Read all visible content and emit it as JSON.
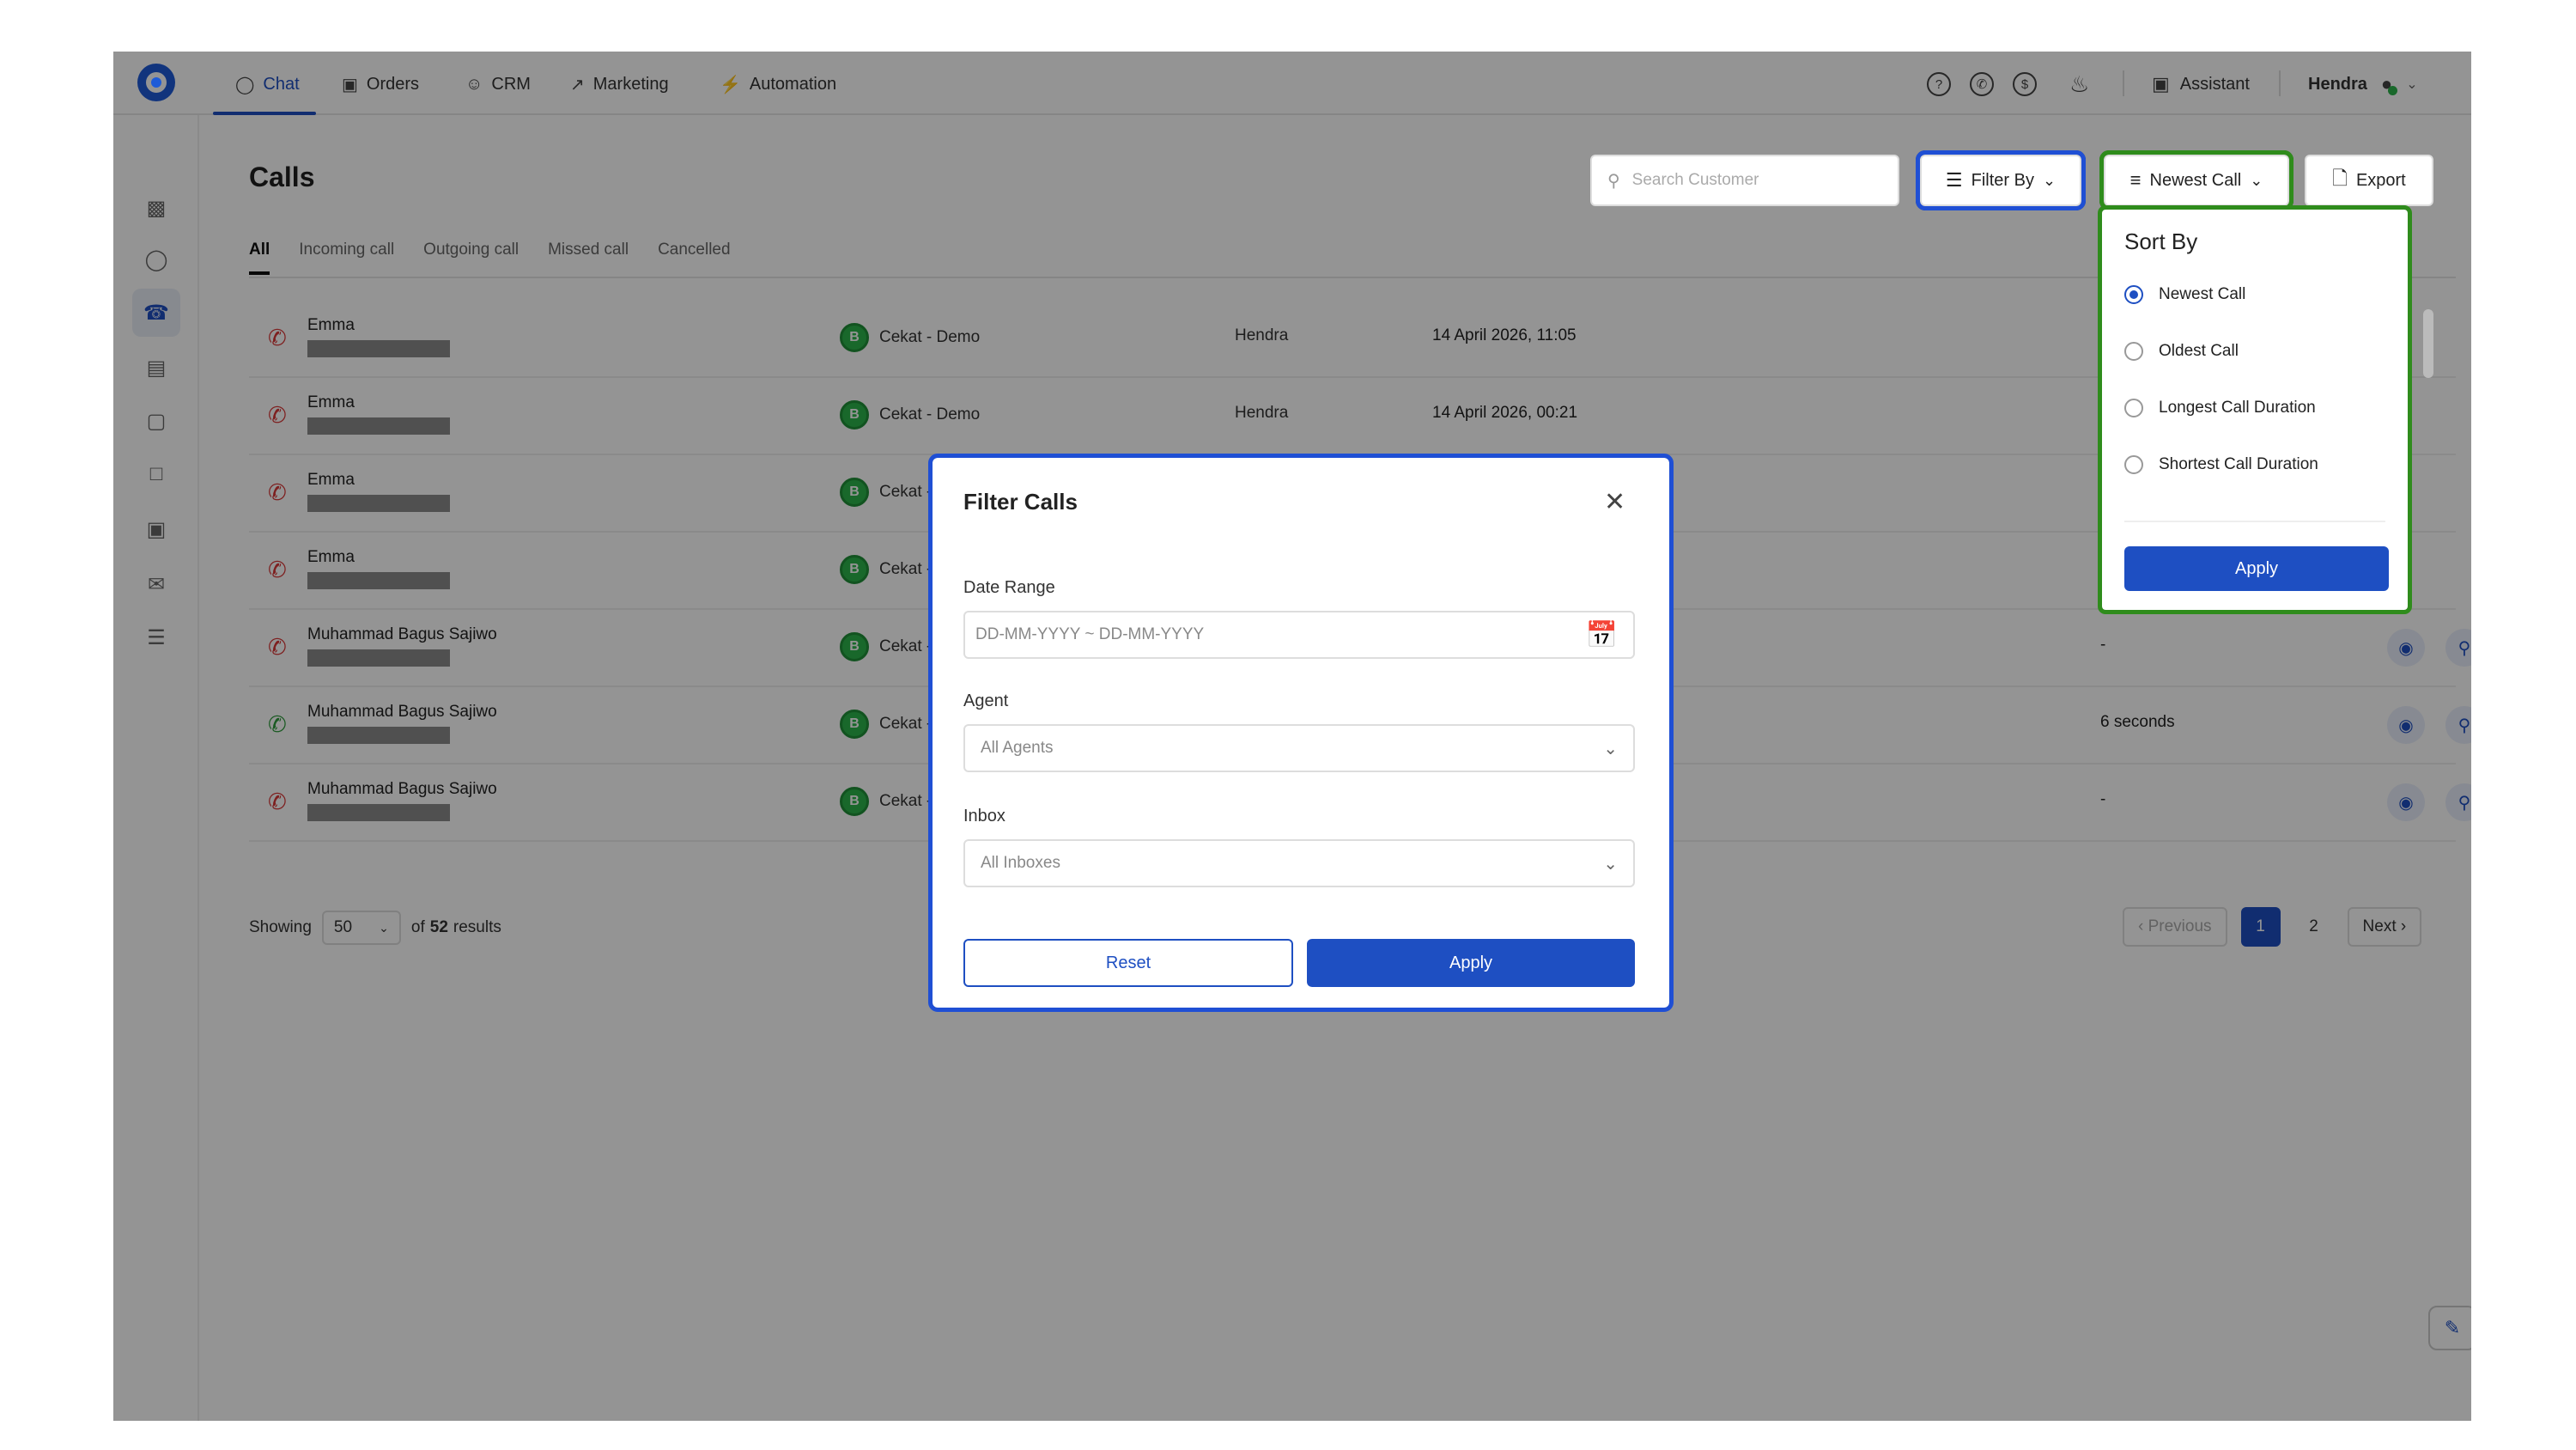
{
  "nav": {
    "tabs": [
      {
        "label": "Chat",
        "icon": "chat-bubble-icon"
      },
      {
        "label": "Orders",
        "icon": "box-icon"
      },
      {
        "label": "CRM",
        "icon": "users-icon"
      },
      {
        "label": "Marketing",
        "icon": "trend-icon"
      },
      {
        "label": "Automation",
        "icon": "bolt-icon"
      }
    ],
    "assistant_label": "Assistant",
    "user_name": "Hendra"
  },
  "page": {
    "title": "Calls",
    "search_placeholder": "Search Customer",
    "filter_label": "Filter By",
    "sort_label": "Newest Call",
    "export_label": "Export"
  },
  "tabs": [
    "All",
    "Incoming call",
    "Outgoing call",
    "Missed call",
    "Cancelled"
  ],
  "rows": [
    {
      "name": "Emma",
      "inbox": "Cekat - Demo",
      "agent": "Hendra",
      "date": "14 April 2026, 11:05",
      "duration": "-",
      "type": "missed"
    },
    {
      "name": "Emma",
      "inbox": "Cekat - Demo",
      "agent": "Hendra",
      "date": "14 April 2026, 00:21",
      "duration": "-",
      "type": "missed"
    },
    {
      "name": "Emma",
      "inbox": "Cekat - D",
      "agent": "",
      "date": "",
      "duration": "-",
      "type": "missed"
    },
    {
      "name": "Emma",
      "inbox": "Cekat - D",
      "agent": "",
      "date": "",
      "duration": "-",
      "type": "missed"
    },
    {
      "name": "Muhammad Bagus Sajiwo",
      "inbox": "Cekat - D",
      "agent": "",
      "date": "",
      "duration": "-",
      "type": "missed"
    },
    {
      "name": "Muhammad Bagus Sajiwo",
      "inbox": "Cekat - D",
      "agent": "",
      "date": "",
      "duration": "6 seconds",
      "type": "ok"
    },
    {
      "name": "Muhammad Bagus Sajiwo",
      "inbox": "Cekat - D",
      "agent": "",
      "date": "",
      "duration": "-",
      "type": "missed"
    }
  ],
  "footer": {
    "showing_label": "Showing",
    "per_page": "50",
    "of_label": "of",
    "total": "52",
    "results_label": "results",
    "prev_label": "Previous",
    "pages": [
      "1",
      "2"
    ],
    "next_label": "Next"
  },
  "sort_panel": {
    "title": "Sort By",
    "options": [
      "Newest Call",
      "Oldest Call",
      "Longest Call Duration",
      "Shortest Call Duration"
    ],
    "selected": 0,
    "apply_label": "Apply"
  },
  "modal": {
    "title": "Filter Calls",
    "date_label": "Date Range",
    "date_placeholder": "DD-MM-YYYY ~ DD-MM-YYYY",
    "agent_label": "Agent",
    "agent_value": "All Agents",
    "inbox_label": "Inbox",
    "inbox_value": "All Inboxes",
    "reset_label": "Reset",
    "apply_label": "Apply"
  },
  "colors": {
    "primary": "#1e4fc2",
    "highlight_blue": "#1f4fd4",
    "highlight_green": "#2f8c1c",
    "missed": "#d93636",
    "answered": "#2d9c3c"
  }
}
